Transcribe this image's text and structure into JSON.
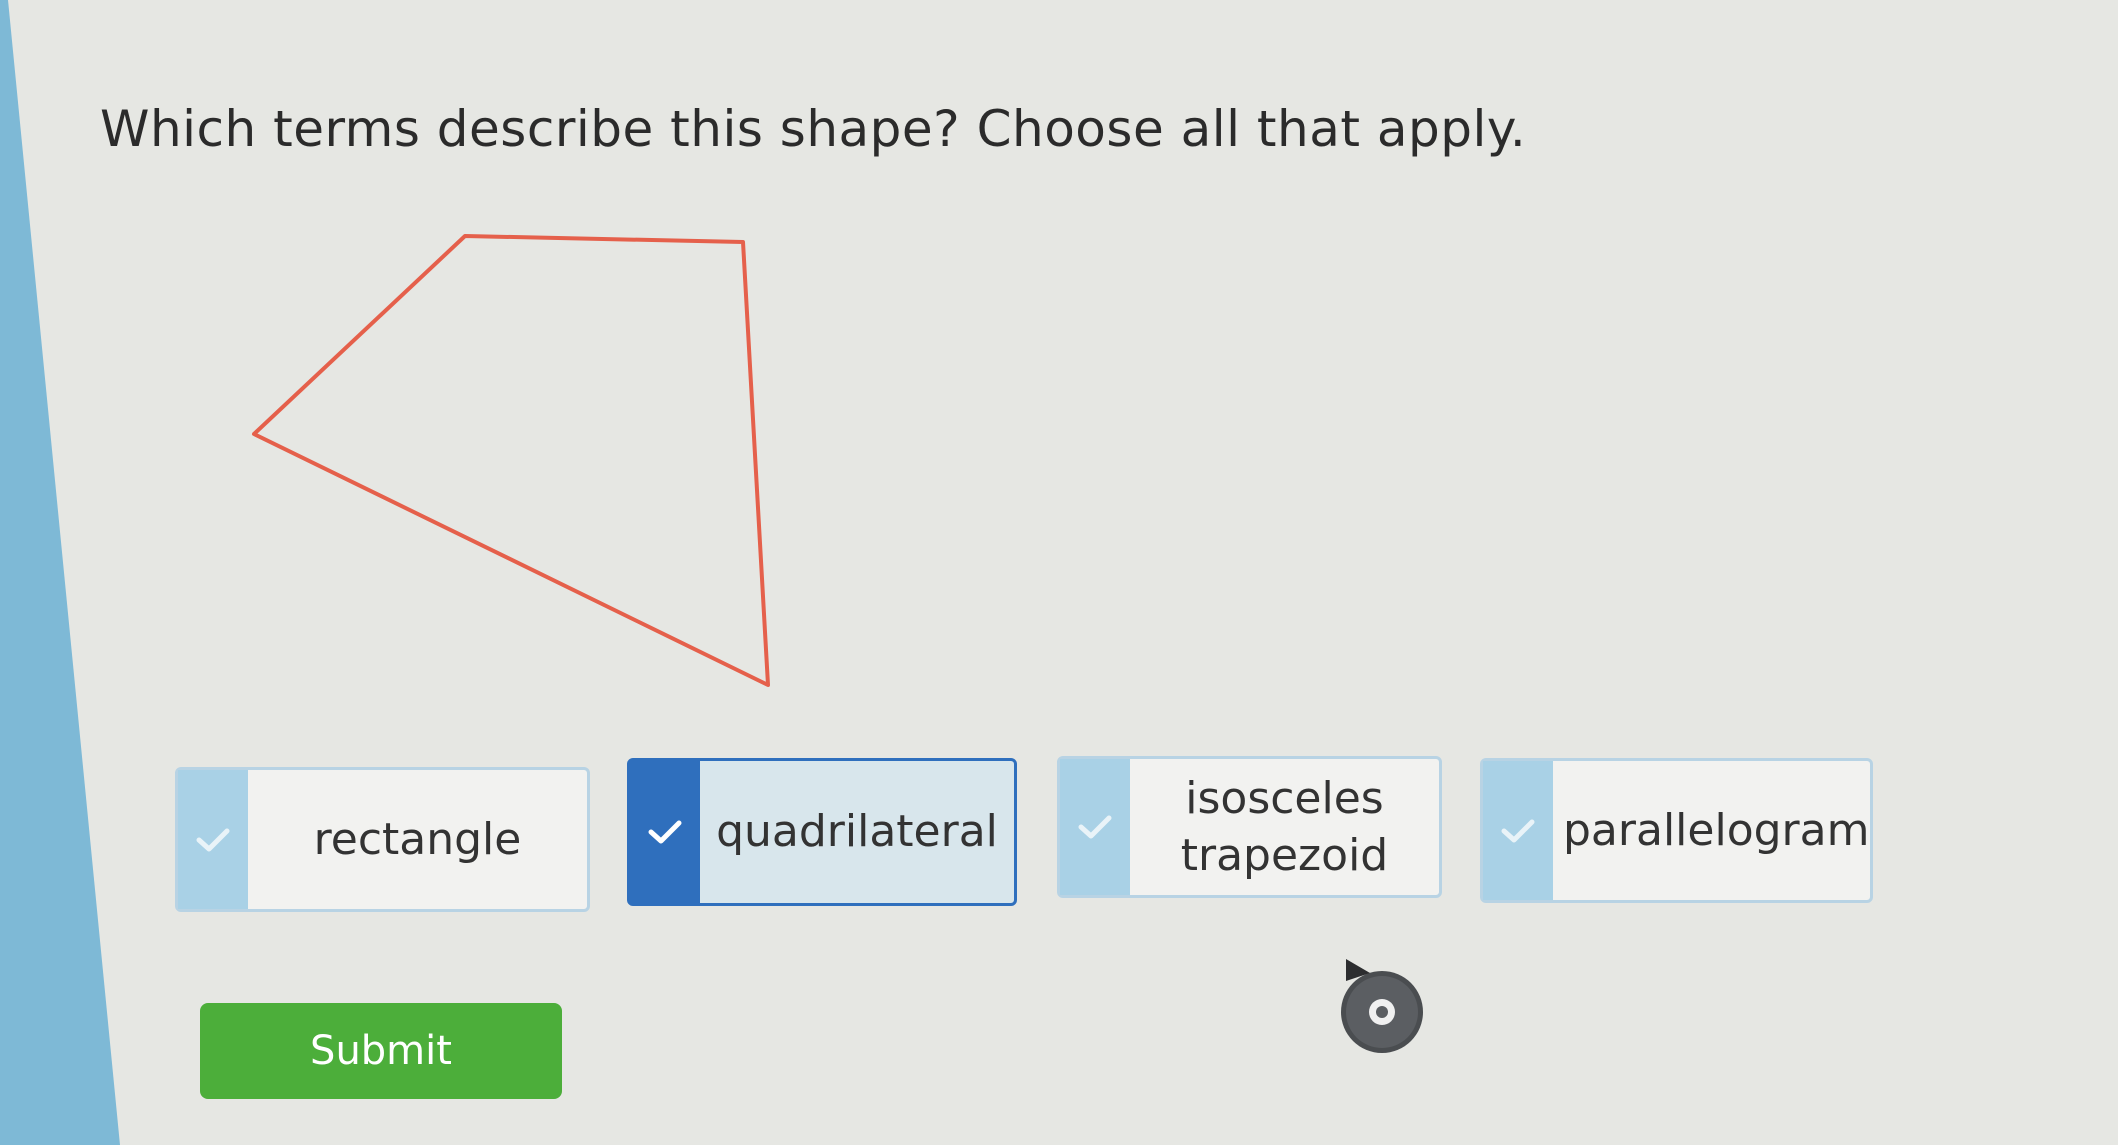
{
  "question": {
    "prompt": "Which terms describe this shape? Choose all that apply."
  },
  "choices": [
    {
      "label": "rectangle",
      "selected": false
    },
    {
      "label": "quadrilateral",
      "selected": true
    },
    {
      "label_line1": "isosceles",
      "label_line2": "trapezoid",
      "selected": false
    },
    {
      "label": "parallelogram",
      "selected": false
    }
  ],
  "submit": {
    "label": "Submit"
  },
  "colors": {
    "shape_stroke": "#e5604b",
    "selected_accent": "#2f6fbd",
    "choice_accent": "#a9d1e6",
    "submit_bg": "#4cae3a",
    "sidebar": "#7eb9d6"
  },
  "icons": {
    "check": "check-icon",
    "cursor": "mouse-cursor-icon"
  }
}
